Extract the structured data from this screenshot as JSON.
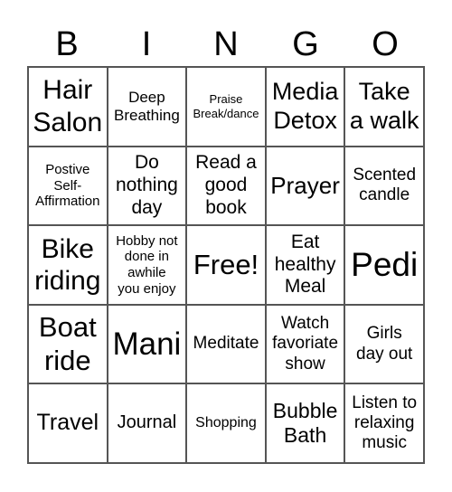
{
  "header": [
    "B",
    "I",
    "N",
    "G",
    "O"
  ],
  "cells": [
    "Hair\nSalon",
    "Deep\nBreathing",
    "Praise\nBreak/dance",
    "Media\nDetox",
    "Take\na walk",
    "Postive\nSelf-\nAffirmation",
    "Do\nnothing\nday",
    "Read a\ngood\nbook",
    "Prayer",
    "Scented\ncandle",
    "Bike\nriding",
    "Hobby not\ndone in\nawhile\nyou enjoy",
    "Free!",
    "Eat\nhealthy\nMeal",
    "Pedi",
    "Boat\nride",
    "Mani",
    "Meditate",
    "Watch\nfavoriate\nshow",
    "Girls\nday out",
    "Travel",
    "Journal",
    "Shopping",
    "Bubble\nBath",
    "Listen to\nrelaxing\nmusic"
  ]
}
